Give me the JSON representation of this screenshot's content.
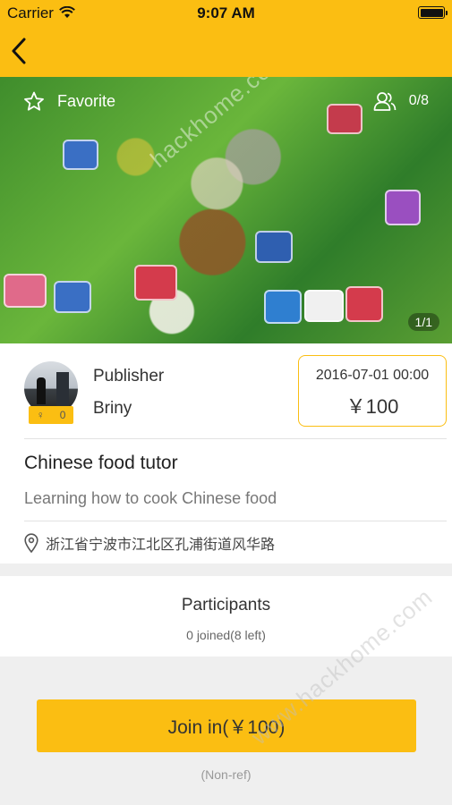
{
  "status_bar": {
    "carrier": "Carrier",
    "time": "9:07 AM"
  },
  "hero": {
    "favorite_label": "Favorite",
    "participants_count": "0/8",
    "image_counter": "1/1"
  },
  "publisher": {
    "label": "Publisher",
    "name": "Briny",
    "gender_symbol": "♀",
    "score": "0"
  },
  "event": {
    "datetime": "2016-07-01 00:00",
    "price": "￥100",
    "title": "Chinese food tutor",
    "description": "Learning how to cook Chinese food",
    "location": "浙江省宁波市江北区孔浦街道风华路"
  },
  "participants": {
    "title": "Participants",
    "summary": "0 joined(8 left)"
  },
  "join": {
    "button_label": "Join in(￥100)",
    "note": "(Non-ref)"
  },
  "watermarks": {
    "top": "hackhome.com",
    "bottom": "www.hackhome.com"
  },
  "colors": {
    "accent": "#fbbe12",
    "background": "#efefef"
  }
}
